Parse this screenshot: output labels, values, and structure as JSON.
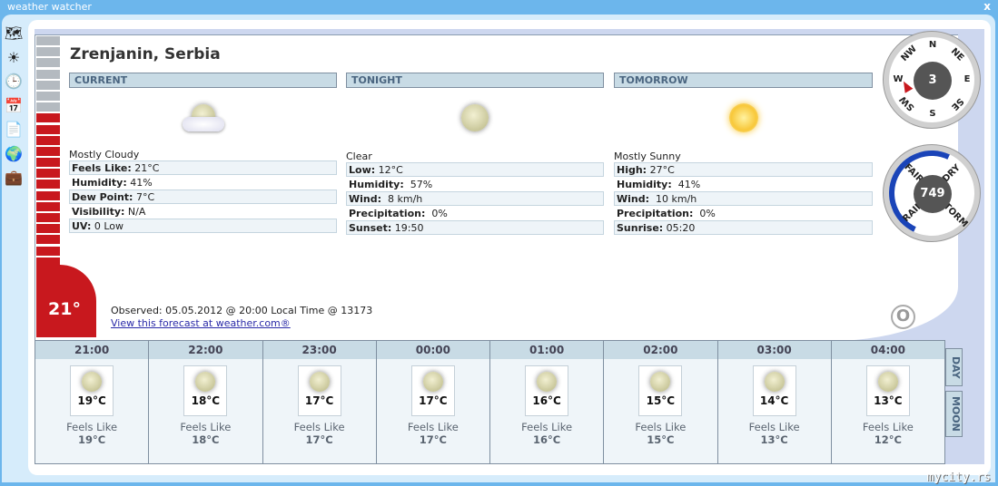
{
  "window": {
    "title": "weather watcher",
    "close": "x"
  },
  "toolbar": [
    {
      "icon": "weather-map-icon",
      "glyph": "🗺"
    },
    {
      "icon": "sun-icon",
      "glyph": "☀"
    },
    {
      "icon": "clock-icon",
      "glyph": "🕒"
    },
    {
      "icon": "calendar-icon",
      "glyph": "📅"
    },
    {
      "icon": "document-icon",
      "glyph": "📄"
    },
    {
      "icon": "globe-icon",
      "glyph": "🌍"
    },
    {
      "icon": "briefcase-icon",
      "glyph": "💼"
    }
  ],
  "location": "Zrenjanin, Serbia",
  "current_temp": "21°",
  "thermometer_level_percent": 67,
  "columns": [
    {
      "header": "CURRENT",
      "icon": "mostly-cloudy-night",
      "condition": "Mostly Cloudy",
      "rows": [
        {
          "k": "Feels Like:",
          "v": " 21°C"
        },
        {
          "k": "Humidity:",
          "v": " 41%"
        },
        {
          "k": "Dew Point:",
          "v": " 7°C"
        },
        {
          "k": "Visibility:",
          "v": " N/A"
        },
        {
          "k": "UV:",
          "v": " 0 Low"
        }
      ]
    },
    {
      "header": "TONIGHT",
      "icon": "clear-night",
      "condition": "Clear",
      "rows": [
        {
          "k": "Low:",
          "v": " 12°C"
        },
        {
          "k": "Humidity:",
          "v": "  57%"
        },
        {
          "k": "Wind:",
          "v": "  8 km/h"
        },
        {
          "k": "Precipitation:",
          "v": "  0%"
        },
        {
          "k": "Sunset:",
          "v": " 19:50"
        }
      ]
    },
    {
      "header": "TOMORROW",
      "icon": "mostly-sunny",
      "condition": "Mostly Sunny",
      "rows": [
        {
          "k": "High:",
          "v": " 27°C"
        },
        {
          "k": "Humidity:",
          "v": "  41%"
        },
        {
          "k": "Wind:",
          "v": "  10 km/h"
        },
        {
          "k": "Precipitation:",
          "v": "  0%"
        },
        {
          "k": "Sunrise:",
          "v": " 05:20"
        }
      ]
    }
  ],
  "observed": "Observed: 05.05.2012 @ 20:00 Local Time @ 13173",
  "link": "View this forecast at weather.com®",
  "compass": {
    "value": "3",
    "labels": [
      "N",
      "NE",
      "E",
      "SE",
      "S",
      "SW",
      "W",
      "NW"
    ],
    "direction": "WSW"
  },
  "barometer": {
    "value": "749",
    "labels": [
      "RAIN",
      "FAIR",
      "DRY",
      "STORM"
    ]
  },
  "hourly": [
    {
      "time": "21:00",
      "temp": "19°C",
      "feels_label": "Feels Like",
      "feels": "19°C"
    },
    {
      "time": "22:00",
      "temp": "18°C",
      "feels_label": "Feels Like",
      "feels": "18°C"
    },
    {
      "time": "23:00",
      "temp": "17°C",
      "feels_label": "Feels Like",
      "feels": "17°C"
    },
    {
      "time": "00:00",
      "temp": "17°C",
      "feels_label": "Feels Like",
      "feels": "17°C"
    },
    {
      "time": "01:00",
      "temp": "16°C",
      "feels_label": "Feels Like",
      "feels": "16°C"
    },
    {
      "time": "02:00",
      "temp": "15°C",
      "feels_label": "Feels Like",
      "feels": "15°C"
    },
    {
      "time": "03:00",
      "temp": "14°C",
      "feels_label": "Feels Like",
      "feels": "13°C"
    },
    {
      "time": "04:00",
      "temp": "13°C",
      "feels_label": "Feels Like",
      "feels": "12°C"
    }
  ],
  "tabs": {
    "day": "DAY",
    "moon": "MOON"
  },
  "brand": "mycity.rs",
  "colors": {
    "accent": "#6cb6ec",
    "thermo_red": "#c8181e",
    "header": "#c8dbe5"
  }
}
